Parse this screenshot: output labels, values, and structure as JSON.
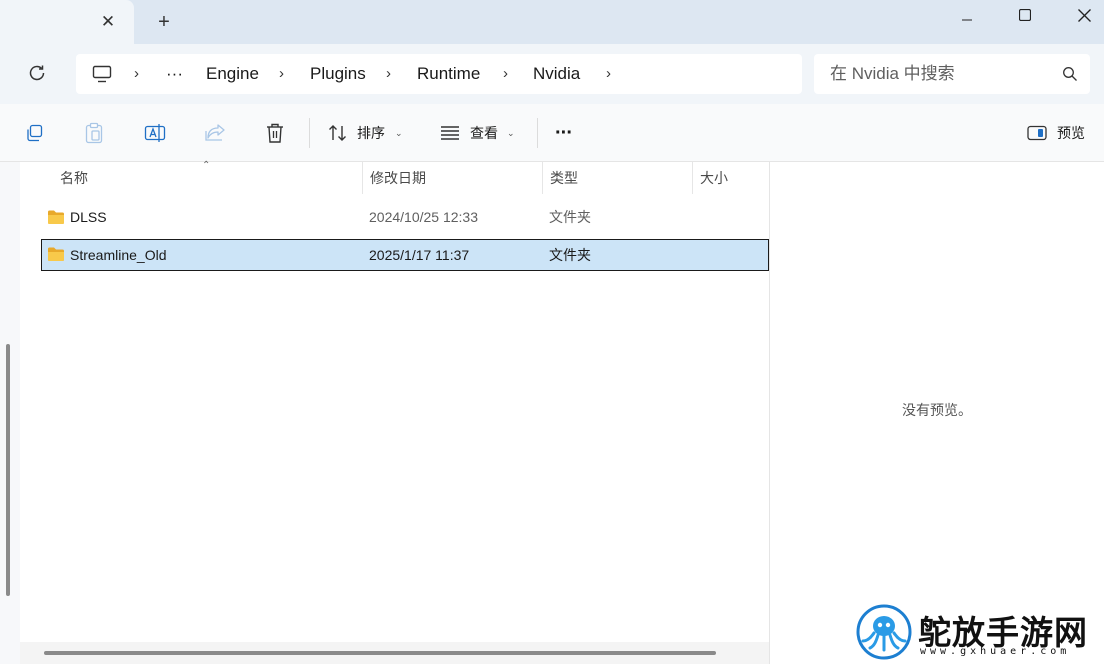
{
  "window": {
    "tab": {
      "close_glyph": "✕"
    },
    "new_tab_glyph": "+"
  },
  "navigation": {
    "overflow": "···",
    "breadcrumb": [
      "Engine",
      "Plugins",
      "Runtime",
      "Nvidia"
    ],
    "separator": "›",
    "search_placeholder": "在 Nvidia 中搜索"
  },
  "toolbar": {
    "sort_label": "排序",
    "view_label": "查看",
    "more_label": "···",
    "preview_label": "预览"
  },
  "columns": {
    "name": "名称",
    "modified": "修改日期",
    "type": "类型",
    "size": "大小"
  },
  "files": [
    {
      "name": "DLSS",
      "modified": "2024/10/25 12:33",
      "type": "文件夹",
      "size": "",
      "selected": false
    },
    {
      "name": "Streamline_Old",
      "modified": "2025/1/17 11:37",
      "type": "文件夹",
      "size": "",
      "selected": true
    }
  ],
  "preview_pane": {
    "message": "没有预览。"
  },
  "watermark": {
    "title": "鸵放手游网",
    "url": "www.gxhuaer.com"
  },
  "colors": {
    "titlebar": "#dde7f2",
    "selection": "#cce4f7",
    "folder": "#f8c94a"
  }
}
